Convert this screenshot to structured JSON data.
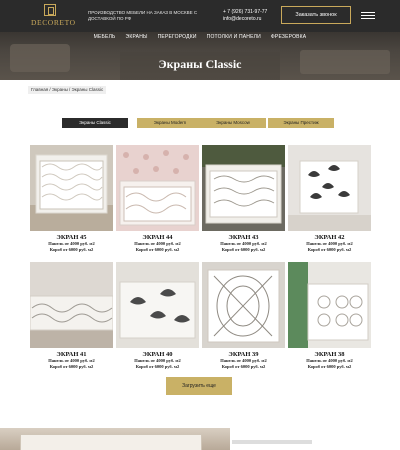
{
  "header": {
    "logo_text": "DECORETO",
    "tagline": "ПРОИЗВОДСТВО МЕБЕЛИ НА ЗАКАЗ В МОСКВЕ С ДОСТАВКОЙ ПО РФ",
    "phone": "+ 7 (926) 731-97-77",
    "email": "info@decoreto.ru",
    "callback_label": "Заказать звонок"
  },
  "nav": [
    {
      "label": "МЕБЕЛЬ"
    },
    {
      "label": "ЭКРАНЫ"
    },
    {
      "label": "ПЕРЕГОРОДКИ"
    },
    {
      "label": "ПОТОЛКИ И ПАНЕЛИ"
    },
    {
      "label": "ФРЕЗЕРОВКА"
    }
  ],
  "hero": {
    "title": "Экраны Classic"
  },
  "breadcrumb": "Главная / Экраны / Экраны Classic",
  "tabs": [
    {
      "label": "Экраны Classic",
      "active": true
    },
    {
      "label": "Экраны Modern",
      "active": false
    },
    {
      "label": "Экраны Moscow",
      "active": false
    },
    {
      "label": "Экраны Престиж",
      "active": false
    }
  ],
  "products": [
    {
      "name": "ЭКРАН 45",
      "price1": "Панель от 4000 руб. м2",
      "price2": "Короб от 6000 руб. м2"
    },
    {
      "name": "ЭКРАН 44",
      "price1": "Панель от 4000 руб. м2",
      "price2": "Короб от 6000 руб. м2"
    },
    {
      "name": "ЭКРАН 43",
      "price1": "Панель от 4000 руб. м2",
      "price2": "Короб от 6000 руб. м2"
    },
    {
      "name": "ЭКРАН 42",
      "price1": "Панель от 4000 руб. м2",
      "price2": "Короб от 6000 руб. м2"
    },
    {
      "name": "ЭКРАН 41",
      "price1": "Панель от 4000 руб. м2",
      "price2": "Короб от 6000 руб. м2"
    },
    {
      "name": "ЭКРАН 40",
      "price1": "Панель от 4000 руб. м2",
      "price2": "Короб от 6000 руб. м2"
    },
    {
      "name": "ЭКРАН 39",
      "price1": "Панель от 4000 руб. м2",
      "price2": "Короб от 6000 руб. м2"
    },
    {
      "name": "ЭКРАН 38",
      "price1": "Панель от 4000 руб. м2",
      "price2": "Короб от 6000 руб. м2"
    }
  ],
  "more_label": "Загрузить еще",
  "colors": {
    "accent": "#c9b166",
    "dark": "#2b2b2b",
    "gold": "#c9a95b"
  },
  "icons": {
    "logo": "decoreto-logo",
    "menu": "burger-menu-icon"
  }
}
